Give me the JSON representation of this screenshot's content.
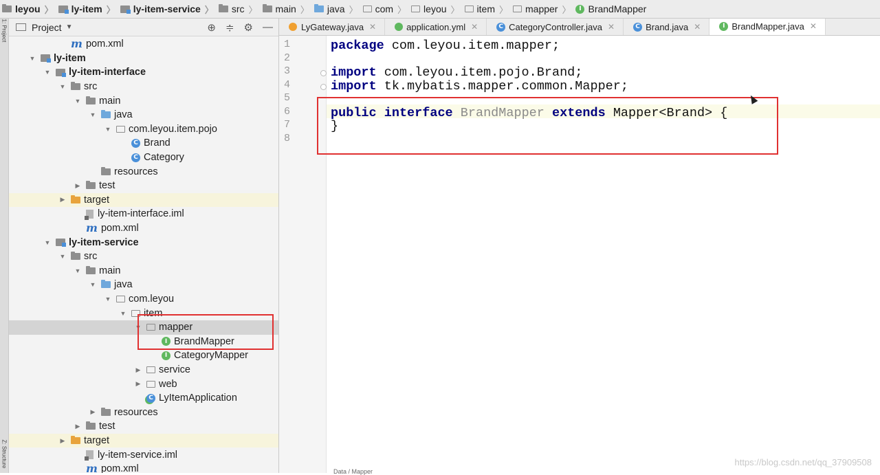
{
  "breadcrumb": [
    {
      "label": "leyou",
      "icon": "folder-icon",
      "bold": true
    },
    {
      "label": "ly-item",
      "icon": "module-folder-icon",
      "bold": true
    },
    {
      "label": "ly-item-service",
      "icon": "module-folder-icon",
      "bold": true
    },
    {
      "label": "src",
      "icon": "folder-icon"
    },
    {
      "label": "main",
      "icon": "folder-icon"
    },
    {
      "label": "java",
      "icon": "source-folder-icon"
    },
    {
      "label": "com",
      "icon": "package-icon"
    },
    {
      "label": "leyou",
      "icon": "package-icon"
    },
    {
      "label": "item",
      "icon": "package-icon"
    },
    {
      "label": "mapper",
      "icon": "package-icon"
    },
    {
      "label": "BrandMapper",
      "icon": "interface-icon"
    }
  ],
  "project_panel": {
    "title": "Project",
    "side_labels": [
      "1: Project",
      "Z: Structure"
    ],
    "tree": [
      {
        "label": "pom.xml",
        "level": 3,
        "icon": "maven-icon",
        "arrow": "none"
      },
      {
        "label": "ly-item",
        "level": 1,
        "icon": "module-folder-icon",
        "arrow": "down",
        "bold": true
      },
      {
        "label": "ly-item-interface",
        "level": 2,
        "icon": "module-folder-icon",
        "arrow": "down",
        "bold": true
      },
      {
        "label": "src",
        "level": 3,
        "icon": "folder-icon",
        "arrow": "down"
      },
      {
        "label": "main",
        "level": 4,
        "icon": "folder-icon",
        "arrow": "down"
      },
      {
        "label": "java",
        "level": 5,
        "icon": "source-folder-icon",
        "arrow": "down"
      },
      {
        "label": "com.leyou.item.pojo",
        "level": 6,
        "icon": "package-icon",
        "arrow": "down"
      },
      {
        "label": "Brand",
        "level": 7,
        "icon": "class-icon",
        "arrow": "none"
      },
      {
        "label": "Category",
        "level": 7,
        "icon": "class-icon",
        "arrow": "none"
      },
      {
        "label": "resources",
        "level": 5,
        "icon": "resources-folder-icon",
        "arrow": "none"
      },
      {
        "label": "test",
        "level": 4,
        "icon": "folder-icon",
        "arrow": "right"
      },
      {
        "label": "target",
        "level": 3,
        "icon": "excluded-folder-icon",
        "arrow": "right",
        "target": true
      },
      {
        "label": "ly-item-interface.iml",
        "level": 4,
        "icon": "iml-file-icon",
        "arrow": "none"
      },
      {
        "label": "pom.xml",
        "level": 4,
        "icon": "maven-icon",
        "arrow": "none"
      },
      {
        "label": "ly-item-service",
        "level": 2,
        "icon": "module-folder-icon",
        "arrow": "down",
        "bold": true
      },
      {
        "label": "src",
        "level": 3,
        "icon": "folder-icon",
        "arrow": "down"
      },
      {
        "label": "main",
        "level": 4,
        "icon": "folder-icon",
        "arrow": "down"
      },
      {
        "label": "java",
        "level": 5,
        "icon": "source-folder-icon",
        "arrow": "down"
      },
      {
        "label": "com.leyou",
        "level": 6,
        "icon": "package-icon",
        "arrow": "down"
      },
      {
        "label": "item",
        "level": 7,
        "icon": "package-icon",
        "arrow": "down"
      },
      {
        "label": "mapper",
        "level": 8,
        "icon": "package-icon",
        "arrow": "down",
        "selected": true
      },
      {
        "label": "BrandMapper",
        "level": 9,
        "icon": "interface-icon",
        "arrow": "none"
      },
      {
        "label": "CategoryMapper",
        "level": 9,
        "icon": "interface-icon",
        "arrow": "none"
      },
      {
        "label": "service",
        "level": 8,
        "icon": "package-icon",
        "arrow": "right"
      },
      {
        "label": "web",
        "level": 8,
        "icon": "package-icon",
        "arrow": "right"
      },
      {
        "label": "LyItemApplication",
        "level": 8,
        "icon": "spring-app-icon",
        "arrow": "none"
      },
      {
        "label": "resources",
        "level": 5,
        "icon": "resources-folder-icon",
        "arrow": "right"
      },
      {
        "label": "test",
        "level": 4,
        "icon": "folder-icon",
        "arrow": "right"
      },
      {
        "label": "target",
        "level": 3,
        "icon": "excluded-folder-icon",
        "arrow": "right",
        "target": true
      },
      {
        "label": "ly-item-service.iml",
        "level": 4,
        "icon": "iml-file-icon",
        "arrow": "none"
      },
      {
        "label": "pom.xml",
        "level": 4,
        "icon": "maven-icon",
        "arrow": "none"
      }
    ]
  },
  "tabs": [
    {
      "label": "LyGateway.java",
      "icon": "java-file-icon"
    },
    {
      "label": "application.yml",
      "icon": "yml-file-icon"
    },
    {
      "label": "CategoryController.java",
      "icon": "class-icon"
    },
    {
      "label": "Brand.java",
      "icon": "class-icon"
    },
    {
      "label": "BrandMapper.java",
      "icon": "interface-icon",
      "active": true
    }
  ],
  "editor": {
    "line_numbers": [
      "1",
      "2",
      "3",
      "4",
      "5",
      "6",
      "7",
      "8"
    ],
    "lines": [
      [
        {
          "t": "package",
          "c": "kw"
        },
        {
          "t": " com.leyou.item.mapper;",
          "c": ""
        }
      ],
      [],
      [
        {
          "t": "import",
          "c": "kw"
        },
        {
          "t": " com.leyou.item.pojo.Brand;",
          "c": ""
        }
      ],
      [
        {
          "t": "import",
          "c": "kw"
        },
        {
          "t": " tk.mybatis.mapper.common.Mapper;",
          "c": ""
        }
      ],
      [],
      [
        {
          "t": "public",
          "c": "kw"
        },
        {
          "t": " ",
          "c": ""
        },
        {
          "t": "interface",
          "c": "kw"
        },
        {
          "t": " ",
          "c": ""
        },
        {
          "t": "BrandMapper",
          "c": "iface"
        },
        {
          "t": " ",
          "c": ""
        },
        {
          "t": "extends",
          "c": "kw"
        },
        {
          "t": " Mapper<Brand> {",
          "c": ""
        }
      ],
      [
        {
          "t": "}",
          "c": ""
        }
      ],
      []
    ]
  },
  "watermark": "https://blog.csdn.net/qq_37909508",
  "bottom_stub": "Data / Mapper"
}
